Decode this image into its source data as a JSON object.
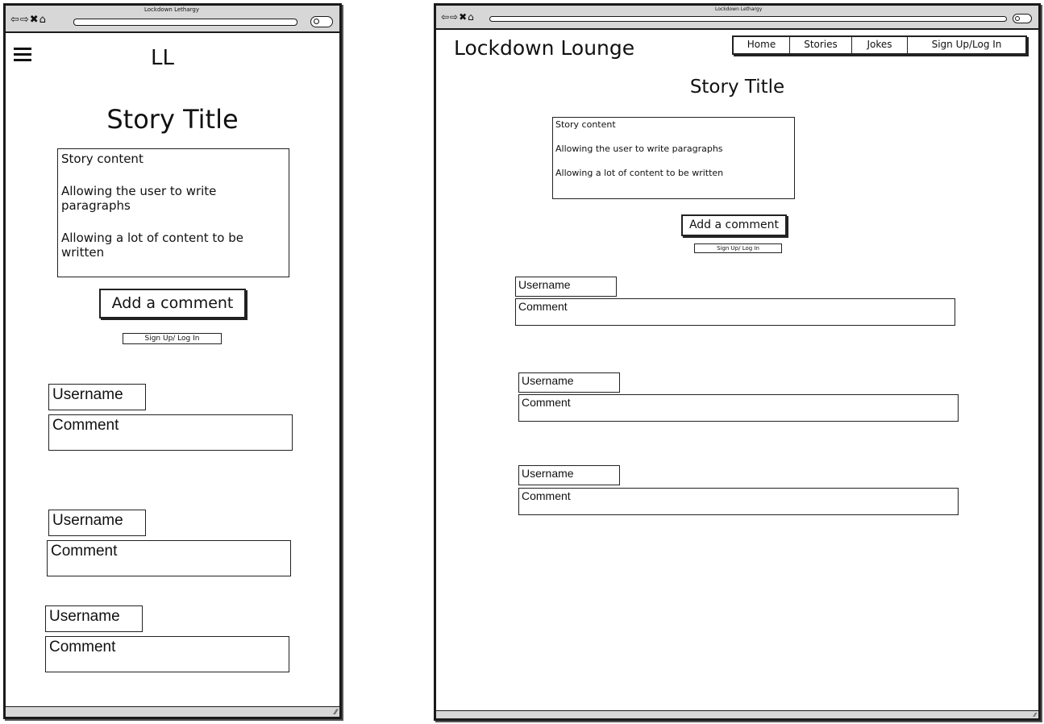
{
  "browser": {
    "title": "Lockdown Lethargy",
    "nav_glyphs": "⇦⇨✖⌂"
  },
  "mobile": {
    "logo": "LL",
    "story_title": "Story Title",
    "story_content": [
      "Story content",
      "Allowing the user to write paragraphs",
      "Allowing a lot of content to be written"
    ],
    "add_comment_label": "Add a comment",
    "signup_label": "Sign Up/ Log In",
    "comments": [
      {
        "username": "Username",
        "comment": "Comment"
      },
      {
        "username": "Username",
        "comment": "Comment"
      },
      {
        "username": "Username",
        "comment": "Comment"
      }
    ]
  },
  "desktop": {
    "site_title": "Lockdown Lounge",
    "nav": [
      "Home",
      "Stories",
      "Jokes",
      "Sign Up/Log In"
    ],
    "story_title": "Story Title",
    "story_content": [
      "Story content",
      "Allowing the user to write paragraphs",
      "Allowing a lot of content to be written"
    ],
    "add_comment_label": "Add a comment",
    "signup_label": "Sign Up/ Log In",
    "comments": [
      {
        "username": "Username",
        "comment": "Comment"
      },
      {
        "username": "Username",
        "comment": "Comment"
      },
      {
        "username": "Username",
        "comment": "Comment"
      }
    ]
  },
  "icons": {
    "menu": "hamburger-menu-icon",
    "search": "search-icon",
    "resize": "resize-grip-icon"
  },
  "colors": {
    "chrome": "#d7d7d7",
    "border": "#1a1a1a",
    "background": "#ffffff"
  }
}
